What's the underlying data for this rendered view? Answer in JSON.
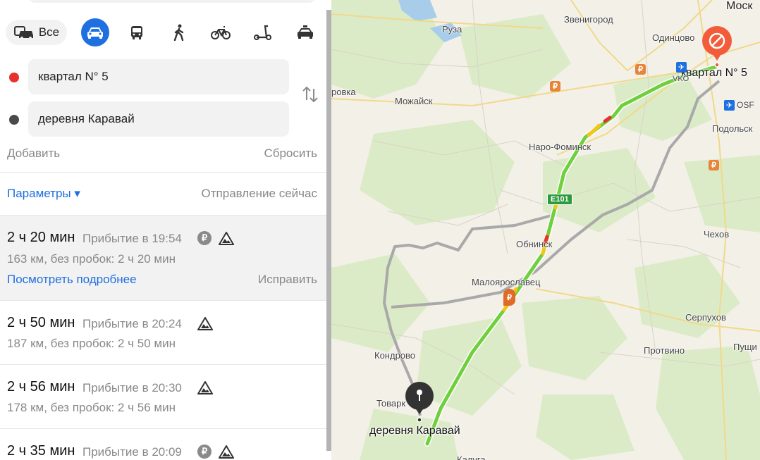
{
  "transport_modes": {
    "all_label": "Все",
    "items": [
      {
        "id": "car",
        "icon": "car-icon",
        "active": true
      },
      {
        "id": "bus",
        "icon": "bus-icon",
        "active": false
      },
      {
        "id": "walk",
        "icon": "pedestrian-icon",
        "active": false
      },
      {
        "id": "bike",
        "icon": "bicycle-icon",
        "active": false
      },
      {
        "id": "scooter",
        "icon": "scooter-icon",
        "active": false
      },
      {
        "id": "taxi",
        "icon": "taxi-icon",
        "active": false
      }
    ]
  },
  "points": {
    "from": {
      "value": "квартал N° 5",
      "dot_color": "#e5322d"
    },
    "to": {
      "value": "деревня Каравай",
      "dot_color": "#4a4a4a"
    }
  },
  "actions": {
    "add": "Добавить",
    "reset": "Сбросить"
  },
  "options": {
    "params": "Параметры ▾",
    "departure": "Отправление сейчас"
  },
  "routes": [
    {
      "duration": "2 ч 20 мин",
      "arrival": "Прибытие в 19:54",
      "details": "163 км, без пробок: 2 ч 20 мин",
      "toll": true,
      "more": "Посмотреть подробнее",
      "fix": "Исправить",
      "selected": true
    },
    {
      "duration": "2 ч 50 мин",
      "arrival": "Прибытие в 20:24",
      "details": "187 км, без пробок: 2 ч 50 мин",
      "toll": false,
      "selected": false
    },
    {
      "duration": "2 ч 56 мин",
      "arrival": "Прибытие в 20:30",
      "details": "178 км, без пробок: 2 ч 56 мин",
      "toll": false,
      "selected": false
    },
    {
      "duration": "2 ч 35 мин",
      "arrival": "Прибытие в 20:09",
      "details": "",
      "toll": true,
      "selected": false
    }
  ],
  "toll_symbol": "₽",
  "map": {
    "places": [
      "Москва",
      "Руза",
      "Звенигород",
      "Одинцово",
      "Можайск",
      "Наро-Фоминск",
      "Подольск",
      "Обнинск",
      "Чехов",
      "Малоярославец",
      "Серпухов",
      "Кондрово",
      "Товарково",
      "Протвино",
      "Пущино",
      "Калуга",
      "Уваровка"
    ],
    "place_labels_truncated": {
      "moscow": "Моск",
      "uvarovka": "ровка",
      "tovarkovo": "Товарк",
      "pushchino": "Пущи",
      "kaluga": "Калуга"
    },
    "start_label": "квартал N° 5",
    "end_label": "деревня Каравай",
    "highway_badge": "E101",
    "airport_label": "OSF",
    "airport_label2": "VKO",
    "route_colors": {
      "main": "#6fcf3c",
      "jam": "#f5c518",
      "alt": "#a9a9a9"
    }
  }
}
